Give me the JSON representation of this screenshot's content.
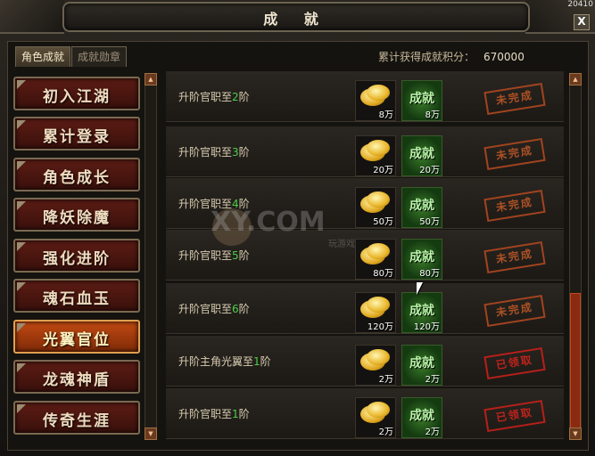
{
  "window": {
    "title": "成 就",
    "top_number": "20410",
    "close": "X"
  },
  "tabs": [
    {
      "label": "角色成就",
      "active": true
    },
    {
      "label": "成就勋章",
      "active": false
    }
  ],
  "score": {
    "label": "累计获得成就积分：",
    "value": "670000"
  },
  "categories": [
    {
      "label": "初入江湖"
    },
    {
      "label": "累计登录"
    },
    {
      "label": "角色成长"
    },
    {
      "label": "降妖除魔"
    },
    {
      "label": "强化进阶"
    },
    {
      "label": "魂石血玉"
    },
    {
      "label": "光翼官位",
      "selected": true
    },
    {
      "label": "龙魂神盾"
    },
    {
      "label": "传奇生涯"
    }
  ],
  "achievements": [
    {
      "prefix": "升阶官职至",
      "level": "2",
      "suffix": "阶",
      "gold": "8万",
      "badge_text": "成就",
      "points": "8万",
      "status": "未完成"
    },
    {
      "prefix": "升阶官职至",
      "level": "3",
      "suffix": "阶",
      "gold": "20万",
      "badge_text": "成就",
      "points": "20万",
      "status": "未完成"
    },
    {
      "prefix": "升阶官职至",
      "level": "4",
      "suffix": "阶",
      "gold": "50万",
      "badge_text": "成就",
      "points": "50万",
      "status": "未完成"
    },
    {
      "prefix": "升阶官职至",
      "level": "5",
      "suffix": "阶",
      "gold": "80万",
      "badge_text": "成就",
      "points": "80万",
      "status": "未完成"
    },
    {
      "prefix": "升阶官职至",
      "level": "6",
      "suffix": "阶",
      "gold": "120万",
      "badge_text": "成就",
      "points": "120万",
      "status": "未完成"
    },
    {
      "prefix": "升阶主角光翼至",
      "level": "1",
      "suffix": "阶",
      "gold": "2万",
      "badge_text": "成就",
      "points": "2万",
      "status": "已领取"
    },
    {
      "prefix": "升阶官职至",
      "level": "1",
      "suffix": "阶",
      "gold": "2万",
      "badge_text": "成就",
      "points": "2万",
      "status": "已领取"
    }
  ],
  "watermark": {
    "text": "XY.COM",
    "sub": "玩游戏"
  },
  "icons": {
    "close": "close-icon",
    "scroll_up": "arrow-up-icon",
    "scroll_down": "arrow-down-icon",
    "gold": "gold-coins-icon",
    "badge": "achievement-badge-icon"
  }
}
